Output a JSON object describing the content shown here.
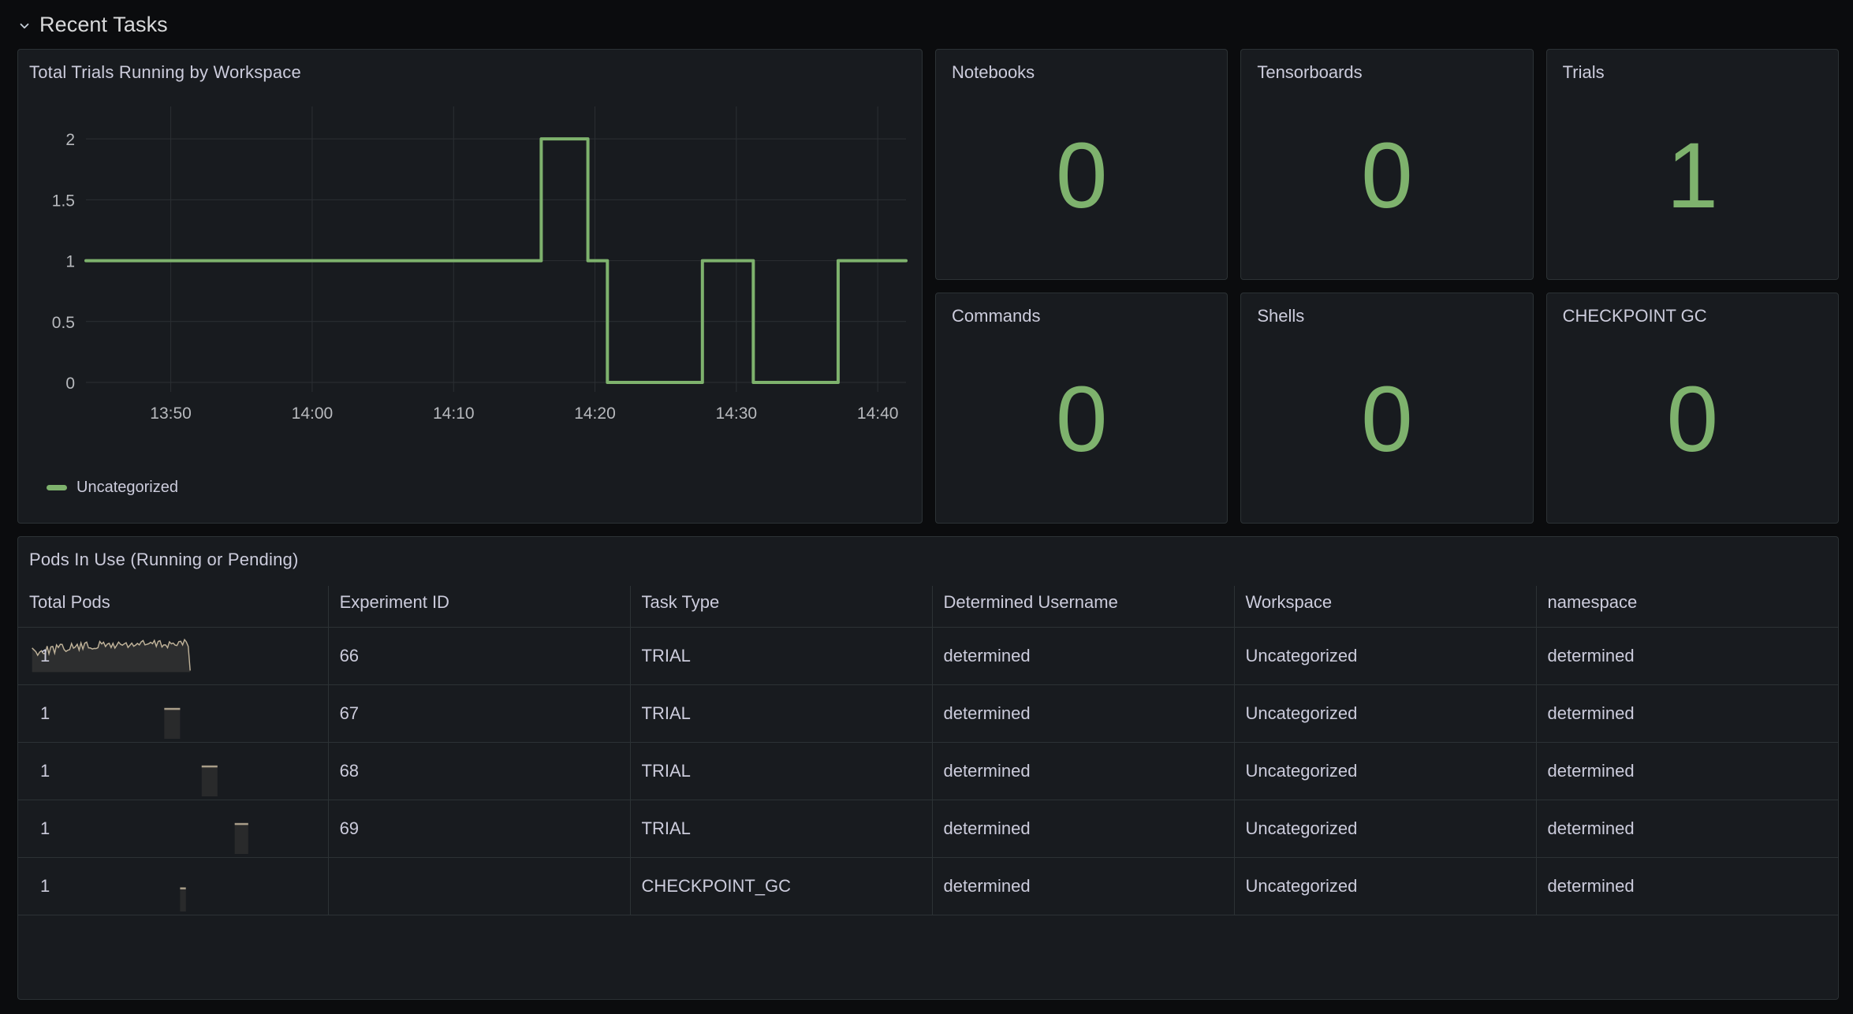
{
  "row": {
    "title": "Recent Tasks",
    "collapse_icon": "chevron-down-icon",
    "expanded": true
  },
  "timeseries_panel": {
    "title": "Total Trials Running by Workspace",
    "legend": [
      {
        "label": "Uncategorized",
        "color": "#7eb26d"
      }
    ]
  },
  "chart_data": {
    "type": "line",
    "title": "Total Trials Running by Workspace",
    "xlabel": "",
    "ylabel": "",
    "line_interpolation": "stepAfter",
    "grid": true,
    "legend_position": "bottom-left",
    "ylim": [
      0,
      2.15
    ],
    "yticks": [
      "0",
      "0.5",
      "1",
      "1.5",
      "2"
    ],
    "ytick_values": [
      0,
      0.5,
      1,
      1.5,
      2
    ],
    "xticks": [
      "13:50",
      "14:00",
      "14:10",
      "14:20",
      "14:30",
      "14:40"
    ],
    "xtick_values": [
      13.8333,
      14.0,
      14.1667,
      14.3333,
      14.5,
      14.6667
    ],
    "xlim": [
      13.7333,
      14.7
    ],
    "series": [
      {
        "name": "Uncategorized",
        "color": "#7eb26d",
        "points": [
          {
            "t": 13.7333,
            "v": 1
          },
          {
            "t": 14.27,
            "v": 1
          },
          {
            "t": 14.27,
            "v": 2
          },
          {
            "t": 14.325,
            "v": 2
          },
          {
            "t": 14.325,
            "v": 1
          },
          {
            "t": 14.348,
            "v": 1
          },
          {
            "t": 14.348,
            "v": 0
          },
          {
            "t": 14.46,
            "v": 0
          },
          {
            "t": 14.46,
            "v": 1
          },
          {
            "t": 14.52,
            "v": 1
          },
          {
            "t": 14.52,
            "v": 0
          },
          {
            "t": 14.62,
            "v": 0
          },
          {
            "t": 14.62,
            "v": 1
          },
          {
            "t": 14.7,
            "v": 1
          }
        ]
      }
    ]
  },
  "stats": [
    {
      "title": "Notebooks",
      "value": "0",
      "color": "#7eb26d"
    },
    {
      "title": "Tensorboards",
      "value": "0",
      "color": "#7eb26d"
    },
    {
      "title": "Trials",
      "value": "1",
      "color": "#7eb26d"
    },
    {
      "title": "Commands",
      "value": "0",
      "color": "#7eb26d"
    },
    {
      "title": "Shells",
      "value": "0",
      "color": "#7eb26d"
    },
    {
      "title": "CHECKPOINT GC",
      "value": "0",
      "color": "#7eb26d"
    }
  ],
  "table_panel": {
    "title": "Pods In Use (Running or Pending)",
    "columns": [
      "Total Pods",
      "Experiment ID",
      "Task Type",
      "Determined Username",
      "Workspace",
      "namespace"
    ],
    "rows": [
      {
        "total_pods": "1",
        "experiment_id": "66",
        "task_type": "TRIAL",
        "username": "determined",
        "workspace": "Uncategorized",
        "namespace": "determined",
        "spark_kind": "full",
        "spark_start": 0.01,
        "spark_end": 0.56
      },
      {
        "total_pods": "1",
        "experiment_id": "67",
        "task_type": "TRIAL",
        "username": "determined",
        "workspace": "Uncategorized",
        "namespace": "determined",
        "spark_kind": "stub",
        "spark_start": 0.47,
        "spark_end": 0.525
      },
      {
        "total_pods": "1",
        "experiment_id": "68",
        "task_type": "TRIAL",
        "username": "determined",
        "workspace": "Uncategorized",
        "namespace": "determined",
        "spark_kind": "stub",
        "spark_start": 0.6,
        "spark_end": 0.655
      },
      {
        "total_pods": "1",
        "experiment_id": "69",
        "task_type": "TRIAL",
        "username": "determined",
        "workspace": "Uncategorized",
        "namespace": "determined",
        "spark_kind": "stub",
        "spark_start": 0.715,
        "spark_end": 0.762
      },
      {
        "total_pods": "1",
        "experiment_id": "",
        "task_type": "CHECKPOINT_GC",
        "username": "determined",
        "workspace": "Uncategorized",
        "namespace": "determined",
        "spark_kind": "thin",
        "spark_start": 0.525,
        "spark_end": 0.545
      }
    ]
  },
  "colors": {
    "accent_green": "#7eb26d",
    "panel_bg": "#181b1f",
    "page_bg": "#0b0c0e",
    "border": "#2c3235",
    "text": "#ccccdc",
    "sparkline": "#c0b39a"
  }
}
